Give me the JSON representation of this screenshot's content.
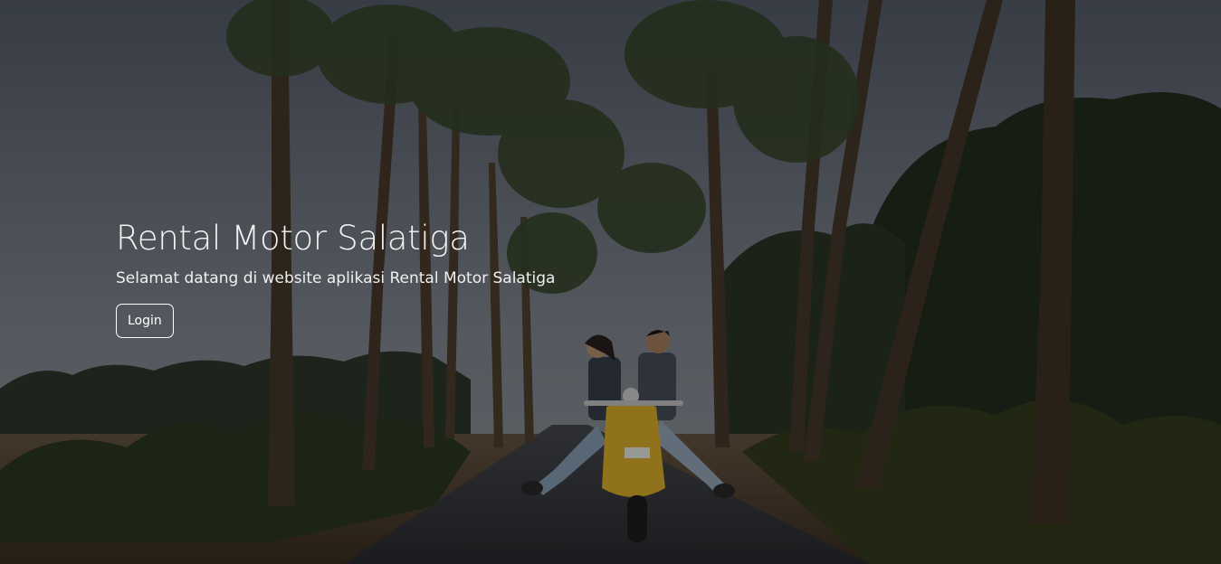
{
  "hero": {
    "title": "Rental Motor Salatiga",
    "subtitle": "Selamat datang di website aplikasi Rental Motor Salatiga",
    "login_label": "Login",
    "background_image": "palm-tree-road-couple-scooter-photo"
  },
  "colors": {
    "overlay": "rgba(0,0,0,0.38)",
    "text": "#ffffff",
    "scooter": "#e8b82e"
  }
}
